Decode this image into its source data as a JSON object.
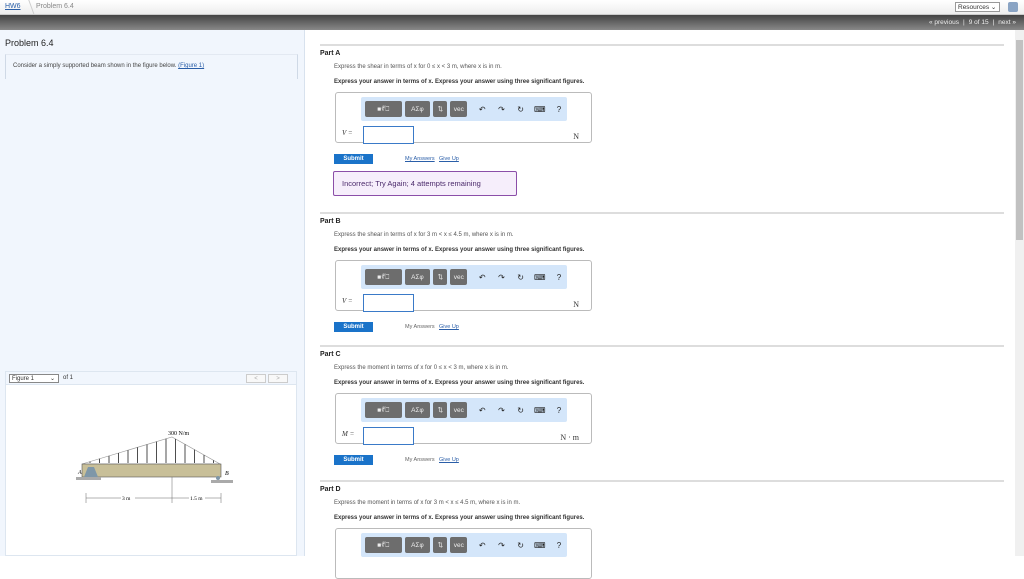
{
  "breadcrumb": {
    "home": "HW6",
    "current": "Problem 6.4"
  },
  "header": {
    "resources": "Resources",
    "previous": "« previous",
    "position": "9 of 15",
    "next": "next »"
  },
  "problem": {
    "title": "Problem 6.4",
    "intro": "Consider a simply supported beam shown in the figure below.",
    "figure_link": "(Figure 1)"
  },
  "figure": {
    "select": "Figure 1",
    "of": "of 1",
    "prev": "<",
    "next": ">",
    "load": "300 N/m",
    "label_a": "A",
    "label_b": "B",
    "dim1": "3 m",
    "dim2": "1.5 m"
  },
  "toolbar": {
    "templates": "■∜⎕",
    "greek": "ΑΣφ",
    "arrows": "⇅",
    "vec": "vec",
    "undo": "↶",
    "redo": "↷",
    "reset": "↻",
    "keyboard": "⌨",
    "help": "?"
  },
  "parts": [
    {
      "label": "Part A",
      "text": "Express the shear in terms of x for 0 ≤ x < 3 m, where x is in m.",
      "instructions": "Express your answer in terms of x. Express your answer using three significant figures.",
      "variable": "V =",
      "unit": "N",
      "submit": "Submit",
      "my_answers": "My Answers",
      "give_up": "Give Up",
      "feedback": "Incorrect; Try Again; 4 attempts remaining"
    },
    {
      "label": "Part B",
      "text": "Express the shear in terms of x for 3 m < x ≤ 4.5 m, where x is in m.",
      "instructions": "Express your answer in terms of x. Express your answer using three significant figures.",
      "variable": "V =",
      "unit": "N",
      "submit": "Submit",
      "my_answers": "My Answers",
      "give_up": "Give Up"
    },
    {
      "label": "Part C",
      "text": "Express the moment in terms of x for 0 ≤ x < 3 m, where x is in m.",
      "instructions": "Express your answer in terms of x. Express your answer using three significant figures.",
      "variable": "M =",
      "unit": "N · m",
      "submit": "Submit",
      "my_answers": "My Answers",
      "give_up": "Give Up"
    },
    {
      "label": "Part D",
      "text": "Express the moment in terms of x for 3 m < x ≤ 4.5 m, where x is in m.",
      "instructions": "Express your answer in terms of x. Express your answer using three significant figures."
    }
  ]
}
